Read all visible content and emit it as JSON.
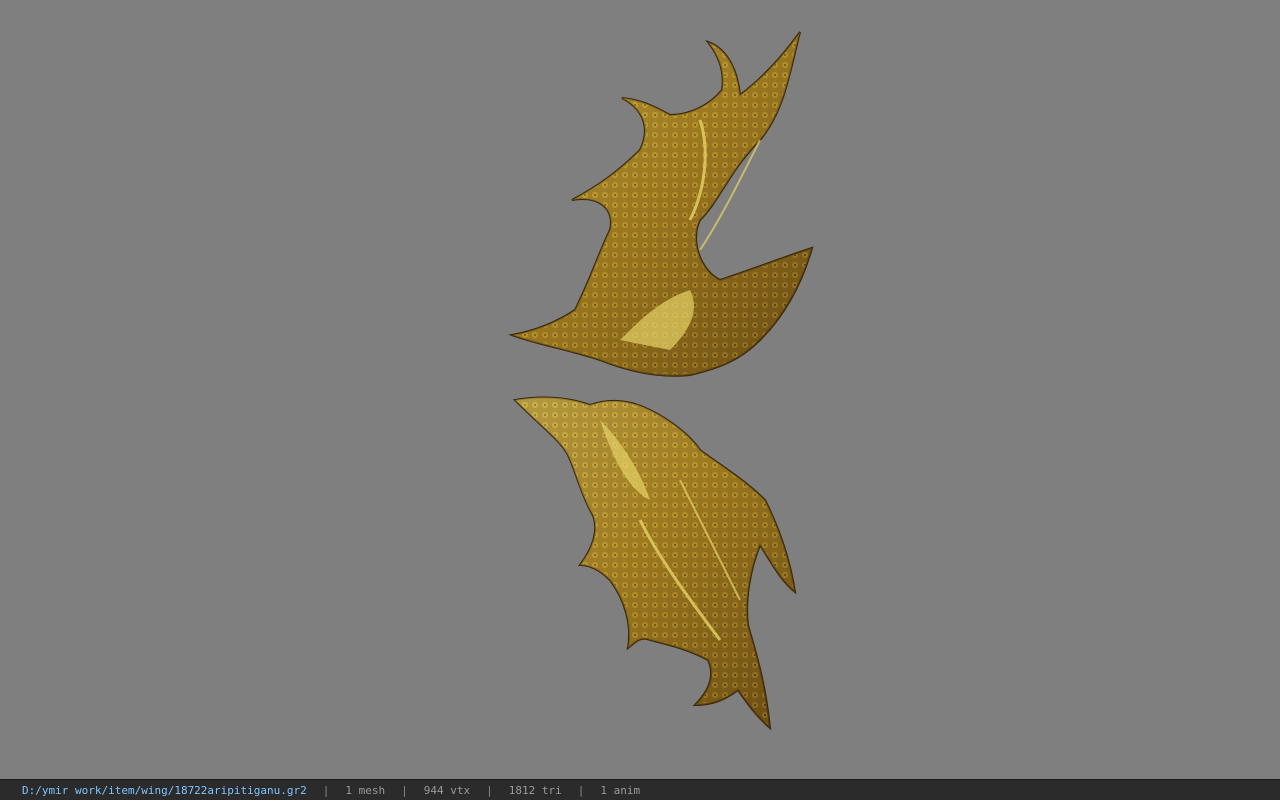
{
  "viewport": {
    "background_color": "#7f7f7f",
    "model_color": "#b8962a",
    "model_highlight_color": "#e6d266",
    "model_shadow_color": "#3a2a0a"
  },
  "status_bar": {
    "file_path": "D:/ymir work/item/wing/18722aripitiganu.gr2",
    "separator": "|",
    "mesh_count": "1 mesh",
    "vertex_count": "944 vtx",
    "triangle_count": "1812 tri",
    "anim_count": "1 anim"
  }
}
